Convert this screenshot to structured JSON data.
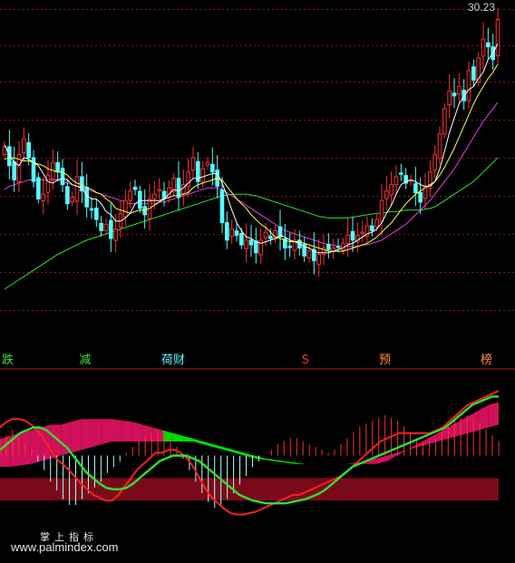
{
  "chart_data": [
    {
      "type": "candlestick",
      "title": "",
      "last_price_label": "30.23",
      "grid": true,
      "legend": "none",
      "ylim": [
        12,
        31
      ],
      "colors": {
        "up": "#ff3030",
        "down": "#54ffff",
        "ma5": "#ffffff",
        "ma10": "#ffff44",
        "ma20": "#e040e0",
        "ma60": "#30e030",
        "grid": "#8a1a1a"
      },
      "close": [
        22.2,
        21.0,
        20.1,
        21.7,
        22.7,
        21.5,
        20.0,
        18.9,
        19.2,
        20.4,
        21.2,
        20.6,
        19.8,
        18.6,
        19.0,
        20.3,
        19.4,
        18.4,
        18.2,
        17.6,
        16.9,
        17.3,
        16.4,
        17.0,
        18.0,
        18.8,
        19.4,
        19.5,
        18.3,
        17.9,
        18.9,
        19.2,
        19.5,
        18.9,
        19.6,
        20.2,
        19.0,
        19.8,
        20.6,
        21.5,
        20.0,
        20.8,
        21.2,
        20.6,
        19.7,
        17.4,
        16.3,
        17.0,
        16.6,
        16.0,
        16.3,
        16.0,
        15.5,
        16.3,
        16.8,
        16.4,
        16.9,
        16.5,
        15.8,
        15.9,
        16.3,
        15.8,
        15.3,
        15.6,
        15.0,
        15.4,
        15.8,
        15.7,
        15.8,
        15.9,
        16.1,
        16.6,
        16.3,
        16.6,
        16.8,
        17.2,
        16.9,
        17.6,
        18.8,
        19.4,
        19.8,
        20.3,
        20.5,
        19.9,
        20.1,
        19.3,
        18.7,
        19.7,
        20.6,
        21.7,
        23.0,
        24.6,
        25.7,
        25.4,
        26.0,
        25.1,
        27.0,
        26.4,
        27.8,
        29.0,
        28.5,
        27.7,
        30.23
      ],
      "ma_lines": [
        {
          "name": "MA5",
          "values": [
            22.3,
            21.7,
            21.2,
            21.0,
            21.5,
            21.4,
            21.2,
            21.0,
            20.5,
            20.0,
            19.9,
            20.1,
            20.2,
            20.1,
            19.8,
            19.7,
            19.6,
            19.1,
            18.9,
            18.9,
            18.6,
            18.1,
            17.9,
            17.5,
            17.5,
            17.7,
            18.0,
            18.6,
            18.8,
            18.8,
            18.8,
            18.8,
            18.8,
            18.9,
            19.2,
            19.5,
            19.4,
            19.6,
            19.9,
            20.2,
            20.2,
            20.3,
            20.4,
            20.5,
            20.5,
            19.9,
            19.1,
            18.2,
            17.4,
            16.9,
            16.5,
            16.4,
            16.2,
            16.1,
            16.2,
            16.3,
            16.4,
            16.6,
            16.5,
            16.3,
            16.2,
            16.1,
            15.9,
            15.8,
            15.6,
            15.5,
            15.5,
            15.5,
            15.6,
            15.7,
            15.8,
            16.0,
            16.1,
            16.3,
            16.5,
            16.7,
            16.8,
            17.0,
            17.4,
            18.0,
            18.5,
            19.2,
            19.8,
            20.0,
            20.1,
            20.0,
            19.8,
            19.7,
            19.7,
            20.0,
            20.8,
            21.9,
            23.1,
            24.0,
            24.9,
            25.4,
            25.8,
            26.0,
            26.5,
            26.9,
            27.7,
            28.1,
            28.7
          ]
        },
        {
          "name": "MA10",
          "values": [
            21.4,
            21.5,
            21.5,
            21.4,
            21.3,
            21.3,
            21.2,
            21.1,
            21.0,
            20.8,
            20.7,
            20.6,
            20.6,
            20.4,
            20.1,
            19.9,
            19.8,
            19.6,
            19.5,
            19.3,
            19.2,
            18.9,
            18.7,
            18.3,
            18.2,
            18.1,
            18.0,
            18.1,
            18.2,
            18.2,
            18.3,
            18.5,
            18.7,
            18.9,
            19.0,
            19.1,
            19.1,
            19.2,
            19.3,
            19.6,
            19.8,
            19.9,
            20.0,
            20.1,
            20.2,
            20.1,
            19.7,
            19.3,
            18.9,
            18.6,
            18.3,
            17.9,
            17.6,
            17.3,
            17.1,
            16.8,
            16.5,
            16.4,
            16.3,
            16.2,
            16.2,
            16.2,
            16.1,
            16.0,
            15.9,
            15.8,
            15.7,
            15.6,
            15.6,
            15.6,
            15.6,
            15.7,
            15.8,
            15.9,
            16.0,
            16.1,
            16.3,
            16.5,
            16.8,
            17.1,
            17.4,
            17.8,
            18.2,
            18.6,
            18.9,
            19.2,
            19.4,
            19.6,
            19.8,
            20.0,
            20.4,
            20.9,
            21.5,
            22.1,
            22.8,
            23.5,
            24.2,
            24.9,
            25.5,
            26.0,
            26.5,
            26.9,
            27.4
          ]
        },
        {
          "name": "MA20",
          "values": [
            19.5,
            19.7,
            19.8,
            19.9,
            20.0,
            20.1,
            20.1,
            20.1,
            20.1,
            20.1,
            20.1,
            20.1,
            20.0,
            19.9,
            19.8,
            19.7,
            19.6,
            19.5,
            19.4,
            19.3,
            19.2,
            19.1,
            19.0,
            18.9,
            18.8,
            18.7,
            18.6,
            18.6,
            18.6,
            18.6,
            18.6,
            18.6,
            18.7,
            18.7,
            18.8,
            18.9,
            19.0,
            19.1,
            19.2,
            19.3,
            19.4,
            19.5,
            19.6,
            19.6,
            19.6,
            19.5,
            19.3,
            19.1,
            18.9,
            18.7,
            18.5,
            18.3,
            18.1,
            17.9,
            17.7,
            17.5,
            17.3,
            17.1,
            16.9,
            16.8,
            16.7,
            16.6,
            16.5,
            16.4,
            16.3,
            16.2,
            16.1,
            16.0,
            16.0,
            15.9,
            15.9,
            15.9,
            15.9,
            15.9,
            16.0,
            16.0,
            16.1,
            16.2,
            16.3,
            16.5,
            16.7,
            16.9,
            17.1,
            17.3,
            17.6,
            17.9,
            18.2,
            18.5,
            18.8,
            19.2,
            19.6,
            20.0,
            20.4,
            20.8,
            21.3,
            21.8,
            22.3,
            22.8,
            23.3,
            23.8,
            24.2,
            24.6,
            25.0
          ]
        },
        {
          "name": "MA60",
          "values": [
            13.2,
            13.4,
            13.6,
            13.8,
            14.0,
            14.2,
            14.4,
            14.6,
            14.8,
            15.0,
            15.2,
            15.4,
            15.55,
            15.7,
            15.85,
            16.0,
            16.15,
            16.3,
            16.4,
            16.5,
            16.6,
            16.7,
            16.8,
            16.9,
            17.0,
            17.1,
            17.2,
            17.3,
            17.4,
            17.5,
            17.6,
            17.7,
            17.8,
            17.9,
            18.0,
            18.1,
            18.2,
            18.3,
            18.4,
            18.5,
            18.6,
            18.7,
            18.8,
            18.9,
            19.0,
            19.1,
            19.15,
            19.2,
            19.2,
            19.2,
            19.2,
            19.15,
            19.1,
            19.0,
            18.9,
            18.8,
            18.7,
            18.6,
            18.5,
            18.4,
            18.3,
            18.2,
            18.1,
            18.0,
            17.9,
            17.8,
            17.75,
            17.7,
            17.7,
            17.7,
            17.7,
            17.7,
            17.75,
            17.8,
            17.85,
            17.9,
            17.95,
            18.0,
            18.0,
            18.05,
            18.1,
            18.1,
            18.15,
            18.2,
            18.2,
            18.2,
            18.2,
            18.25,
            18.3,
            18.4,
            18.6,
            18.8,
            19.0,
            19.2,
            19.4,
            19.6,
            19.8,
            20.0,
            20.3,
            20.6,
            20.9,
            21.2,
            21.5
          ]
        }
      ],
      "annotations": [
        {
          "text": "跌",
          "color": "#40e040",
          "x_index": 0
        },
        {
          "text": "减",
          "color": "#40e040",
          "x_index": 16
        },
        {
          "text": "荷财",
          "color": "#54ffff",
          "x_index": 33
        },
        {
          "text": "S",
          "color": "#ff3030",
          "x_index": 62
        },
        {
          "text": "预",
          "color": "#ff9040",
          "x_index": 78
        },
        {
          "text": "榜",
          "color": "#ff9040",
          "x_index": 99
        }
      ]
    },
    {
      "type": "indicator",
      "title": "",
      "ylim": [
        0,
        100
      ],
      "colors": {
        "fast": "#ff2020",
        "slow": "#30e030",
        "cloud_up": "#d0105a",
        "cloud_down": "#00dd00",
        "band": "#7a0a1a",
        "hist_up": "#ff3030",
        "hist_down": "#b0ffff"
      },
      "fast": [
        70,
        74,
        76,
        76,
        75,
        72,
        68,
        62,
        55,
        48,
        44,
        40,
        35,
        30,
        26,
        22,
        20,
        18,
        18,
        22,
        28,
        34,
        40,
        44,
        48,
        52,
        52,
        54,
        54,
        52,
        48,
        42,
        34,
        26,
        20,
        16,
        12,
        9,
        8,
        8,
        9,
        10,
        12,
        14,
        16,
        18,
        20,
        22,
        22,
        24,
        26,
        28,
        30,
        32,
        34,
        36,
        40,
        44,
        48,
        52,
        56,
        60,
        62,
        64,
        66,
        66,
        66,
        66,
        66,
        66,
        68,
        70,
        74,
        78,
        82,
        86,
        88,
        90,
        92,
        94,
        96
      ],
      "slow": [
        54,
        58,
        62,
        66,
        68,
        70,
        70,
        68,
        64,
        60,
        56,
        50,
        44,
        38,
        34,
        30,
        27,
        26,
        26,
        27,
        30,
        34,
        38,
        42,
        46,
        48,
        50,
        50,
        50,
        48,
        46,
        42,
        38,
        34,
        30,
        26,
        22,
        20,
        18,
        17,
        16,
        16,
        16,
        16,
        17,
        18,
        19,
        21,
        23,
        26,
        30,
        34,
        38,
        42,
        44,
        46,
        48,
        50,
        52,
        54,
        56,
        58,
        60,
        62,
        64,
        66,
        68,
        70,
        74,
        78,
        82,
        86,
        88,
        90,
        92,
        92
      ],
      "cloud_upper": [
        62,
        64,
        66,
        68,
        70,
        72,
        72,
        74,
        76,
        76,
        76,
        76,
        75,
        74,
        72,
        70,
        68,
        66,
        64,
        62,
        60,
        58,
        56,
        54,
        52,
        50,
        48,
        47,
        46,
        45,
        44,
        44,
        44,
        44,
        44,
        44,
        44,
        44,
        46,
        50,
        54,
        58,
        62,
        66,
        70,
        74,
        78,
        82,
        86,
        88
      ],
      "cloud_lower": [
        42,
        42,
        43,
        44,
        46,
        48,
        50,
        52,
        54,
        56,
        58,
        60,
        60,
        60,
        60,
        60,
        60,
        60,
        60,
        60,
        58,
        56,
        54,
        52,
        50,
        48,
        47,
        46,
        45,
        44,
        44,
        44,
        44,
        44,
        44,
        45,
        46,
        48,
        50,
        52,
        54,
        56,
        58,
        60,
        62,
        64,
        66,
        68,
        70,
        72
      ],
      "histogram": [
        10,
        14,
        18,
        12,
        8,
        4,
        -4,
        -10,
        -18,
        -24,
        -30,
        -34,
        -34,
        -30,
        -26,
        -22,
        -18,
        -12,
        -8,
        -4,
        2,
        6,
        10,
        14,
        16,
        18,
        16,
        12,
        6,
        -2,
        -10,
        -18,
        -26,
        -32,
        -36,
        -34,
        -30,
        -26,
        -20,
        -14,
        -8,
        -4,
        0,
        4,
        8,
        10,
        12,
        12,
        10,
        8,
        6,
        4,
        2,
        4,
        8,
        12,
        16,
        20,
        22,
        24,
        26,
        28,
        26,
        24,
        20,
        16,
        12,
        10,
        10,
        12,
        16,
        20,
        24,
        26,
        28,
        26,
        22,
        18,
        14,
        10
      ]
    }
  ],
  "watermark": {
    "cn": "掌上指标",
    "en": "www.palmindex.com"
  }
}
